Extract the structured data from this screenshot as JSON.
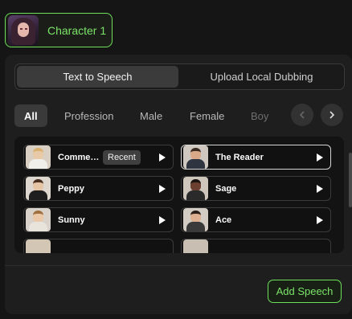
{
  "character": {
    "name": "Character 1"
  },
  "tabs": [
    {
      "label": "Text to Speech",
      "active": true
    },
    {
      "label": "Upload Local Dubbing",
      "active": false
    }
  ],
  "filters": [
    {
      "label": "All",
      "active": true
    },
    {
      "label": "Profession"
    },
    {
      "label": "Male"
    },
    {
      "label": "Female"
    },
    {
      "label": "Boy"
    }
  ],
  "voices": [
    {
      "name": "Comme…",
      "badge": "Recent"
    },
    {
      "name": "The Reader",
      "selected": true
    },
    {
      "name": "Peppy"
    },
    {
      "name": "Sage"
    },
    {
      "name": "Sunny"
    },
    {
      "name": "Ace"
    }
  ],
  "actions": {
    "add_speech": "Add Speech"
  },
  "colors": {
    "accent": "#7be368",
    "panel": "#1e1e1e",
    "background": "#151515"
  }
}
